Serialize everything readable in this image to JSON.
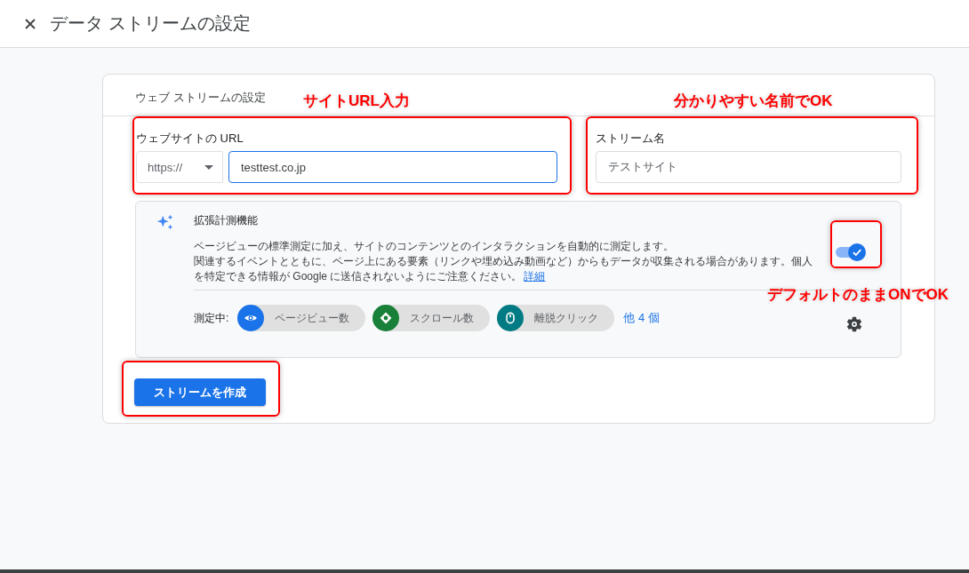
{
  "header": {
    "title": "データ ストリームの設定"
  },
  "card": {
    "title": "ウェブ ストリームの設定",
    "url_field": {
      "label": "ウェブサイトの URL",
      "scheme": "https://",
      "value": "testtest.co.jp"
    },
    "name_field": {
      "label": "ストリーム名",
      "value": "テストサイト"
    },
    "enhanced": {
      "title": "拡張計測機能",
      "description": [
        "ページビューの標準測定に加え、サイトのコンテンツとのインタラクションを自動的に測定します。",
        "関連するイベントとともに、ページ上にある要素（リンクや埋め込み動画など）からもデータが収集される場合があります。個人を特定できる情報が Google に送信されないようにご注意ください。"
      ],
      "link": "詳細",
      "enabled": true,
      "measuring_label": "測定中:",
      "metrics": [
        {
          "kind": "eye",
          "label": "ページビュー数",
          "color": "#1a73e8"
        },
        {
          "kind": "scroll",
          "label": "スクロール数",
          "color": "#188038"
        },
        {
          "kind": "mouse",
          "label": "離脱クリック",
          "color": "#007b83"
        }
      ],
      "more": "他 4 個"
    },
    "create_button": "ストリームを作成"
  },
  "annotations": [
    {
      "text": "サイトURL入力"
    },
    {
      "text": "分かりやすい名前でOK"
    },
    {
      "text": "デフォルトのままONでOK"
    }
  ]
}
